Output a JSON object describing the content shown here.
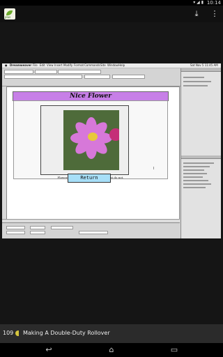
{
  "status_bar": {
    "time": "10:14",
    "icons": [
      "wifi-icon",
      "signal-icon",
      "battery-icon"
    ]
  },
  "action_bar": {
    "app_icon_text": "plus",
    "icons": [
      "download-icon",
      "overflow-menu-icon"
    ]
  },
  "screenshot": {
    "menu": [
      "Dreamweaver",
      "File",
      "Edit",
      "View",
      "Insert",
      "Modify",
      "Format",
      "Commands",
      "Site",
      "Window",
      "Help"
    ],
    "clock": "Sat Nov 5 11:45 AM",
    "page_title": "Nice Flower",
    "caption": "Flowers small size... Zoomy! Some that do not.",
    "return_label": "Return"
  },
  "bottom": {
    "page_number": "109",
    "chapter_title": "Making A Double-Duty Rollover"
  },
  "nav": {
    "back": "back-icon",
    "home": "home-icon",
    "recents": "recents-icon"
  },
  "colors": {
    "title_bg": "#c77fe7",
    "return_bg": "#a7dff8",
    "page_dot": "#d5c53e"
  }
}
